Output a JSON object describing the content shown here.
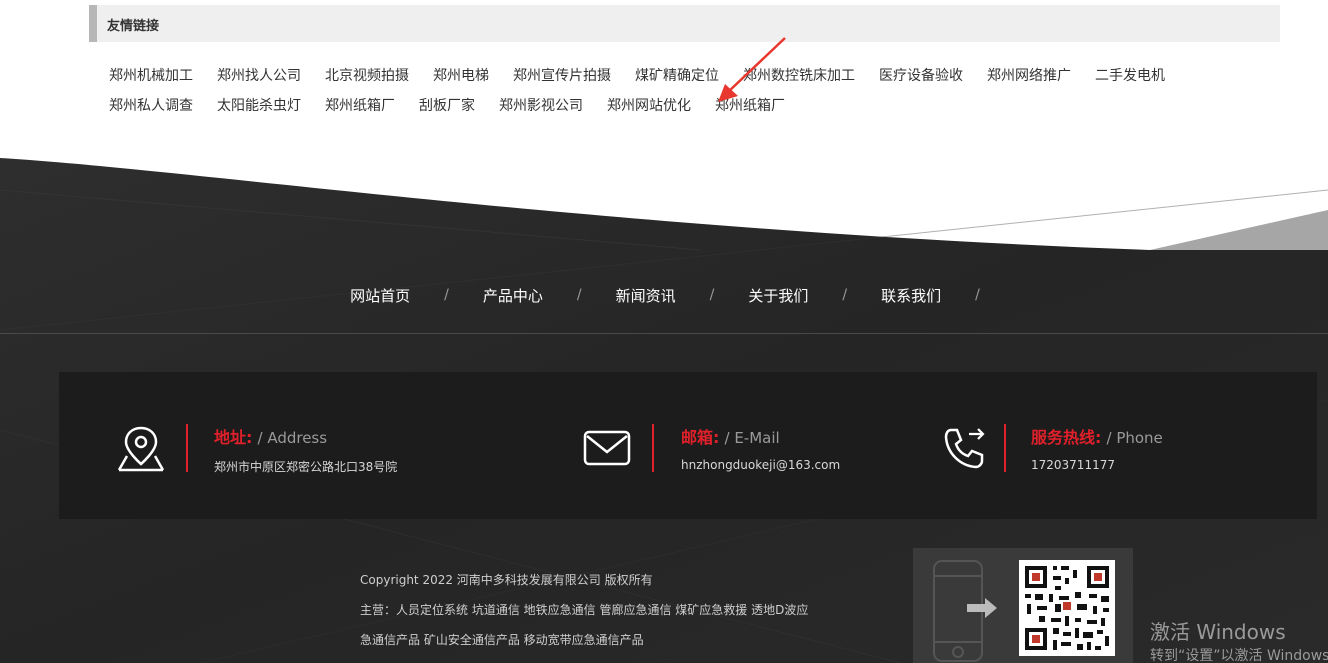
{
  "friend_links": {
    "title": "友情链接",
    "row1": [
      "郑州机械加工",
      "郑州找人公司",
      "北京视频拍摄",
      "郑州电梯",
      "郑州宣传片拍摄",
      "煤矿精确定位",
      "郑州数控铣床加工",
      "医疗设备验收",
      "郑州网络推广",
      "二手发电机"
    ],
    "row2": [
      "郑州私人调查",
      "太阳能杀虫灯",
      "郑州纸箱厂",
      "刮板厂家",
      "郑州影视公司",
      "郑州网站优化",
      "郑州纸箱厂"
    ]
  },
  "nav": {
    "items": [
      "网站首页",
      "产品中心",
      "新闻资讯",
      "关于我们",
      "联系我们"
    ],
    "separator": "/"
  },
  "contact": {
    "address": {
      "label_cn": "地址:",
      "label_en": "/ Address",
      "value": "郑州市中原区郑密公路北口38号院",
      "icon": "location-pin-icon"
    },
    "email": {
      "label_cn": "邮箱:",
      "label_en": "/ E-Mail",
      "value": "hnzhongduokeji@163.com",
      "icon": "envelope-icon"
    },
    "phone": {
      "label_cn": "服务热线:",
      "label_en": "/ Phone",
      "value": "17203711177",
      "icon": "phone-icon"
    }
  },
  "copyright": {
    "line1": "Copyright 2022 河南中多科技发展有限公司 版权所有",
    "line2": "主营：人员定位系统 坑道通信 地铁应急通信 管廊应急通信 煤矿应急救援 透地D波应",
    "line3": "急通信产品 矿山安全通信产品 移动宽带应急通信产品"
  },
  "windows_watermark": {
    "line1": "激活 Windows",
    "line2": "转到“设置”以激活 Windows"
  },
  "colors": {
    "accent_red": "#e0202a",
    "footer_dark": "#262626",
    "annotation_arrow": "#e8372e"
  }
}
